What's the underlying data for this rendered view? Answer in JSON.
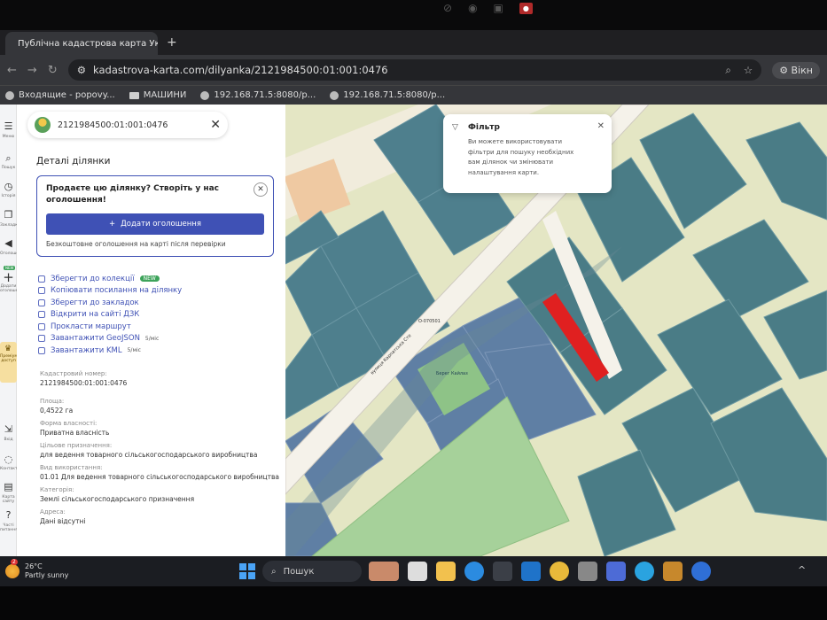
{
  "browser": {
    "tab_title": "Публічна кадастрова карта Ук",
    "url": "kadastrova-karta.com/dilyanka/2121984500:01:001:0476",
    "extension_label": "Вікн",
    "bookmarks": [
      "Входящие - popovy...",
      "МАШИНИ",
      "192.168.71.5:8080/p...",
      "192.168.71.5:8080/p..."
    ]
  },
  "rail": {
    "items": [
      {
        "icon": "menu-icon",
        "label": "Меню"
      },
      {
        "icon": "search-icon",
        "label": "Пошук"
      },
      {
        "icon": "history-icon",
        "label": "Історія"
      },
      {
        "icon": "bookmark-icon",
        "label": "Закладки"
      },
      {
        "icon": "megaphone-icon",
        "label": "Оголошення"
      },
      {
        "icon": "plus-icon",
        "label": "Додати оголошення"
      },
      {
        "icon": "login-icon",
        "label": "Вхід"
      },
      {
        "icon": "chat-icon",
        "label": "Контакти"
      },
      {
        "icon": "map-icon",
        "label": "Карта сайту"
      },
      {
        "icon": "help-icon",
        "label": "Часті питання"
      }
    ],
    "new_badge": "NEW",
    "premium_label": "Преміум доступ"
  },
  "panel": {
    "search_value": "2121984500:01:001:0476",
    "title": "Деталі ділянки",
    "promo": {
      "heading": "Продаєте цю ділянку? Створіть у нас оголошення!",
      "button": "Додати оголошення",
      "note": "Безкоштовне оголошення на карті після перевірки"
    },
    "actions": [
      {
        "label": "Зберегти до колекції",
        "badge": "NEW",
        "suffix": ""
      },
      {
        "label": "Копіювати посилання на ділянку",
        "badge": "",
        "suffix": ""
      },
      {
        "label": "Зберегти до закладок",
        "badge": "",
        "suffix": ""
      },
      {
        "label": "Відкрити на сайті ДЗК",
        "badge": "",
        "suffix": ""
      },
      {
        "label": "Прокласти маршрут",
        "badge": "",
        "suffix": ""
      },
      {
        "label": "Завантажити GeoJSON",
        "badge": "",
        "suffix": "5/міс"
      },
      {
        "label": "Завантажити KML",
        "badge": "",
        "suffix": "5/міс"
      }
    ],
    "properties": [
      {
        "label": "Кадастровий номер:",
        "value": "2121984500:01:001:0476"
      },
      {
        "label": "Площа:",
        "value": "0,4522 га"
      },
      {
        "label": "Форма власності:",
        "value": "Приватна власність"
      },
      {
        "label": "Цільове призначення:",
        "value": "для ведення товарного сільськогосподарського виробництва"
      },
      {
        "label": "Вид використання:",
        "value": "01.01 Для ведення товарного сільськогосподарського виробництва"
      },
      {
        "label": "Категорія:",
        "value": "Землі сільськогосподарського призначення"
      },
      {
        "label": "Адреса:",
        "value": "Дані відсутні"
      }
    ]
  },
  "map": {
    "filter": {
      "title": "Фільтр",
      "body": "Ви можете використовувати фільтри для пошуку необхідних вам ділянок чи змінювати налаштування карти."
    },
    "street_label": "вулиця Карпатська Сте",
    "poi_label": "Берег Кайлаз",
    "road_code": "О-070501",
    "highlight_color": "#e02020"
  },
  "taskbar": {
    "temperature": "26°C",
    "weather": "Partly sunny",
    "weather_badge": "2",
    "search_placeholder": "Пошук"
  }
}
